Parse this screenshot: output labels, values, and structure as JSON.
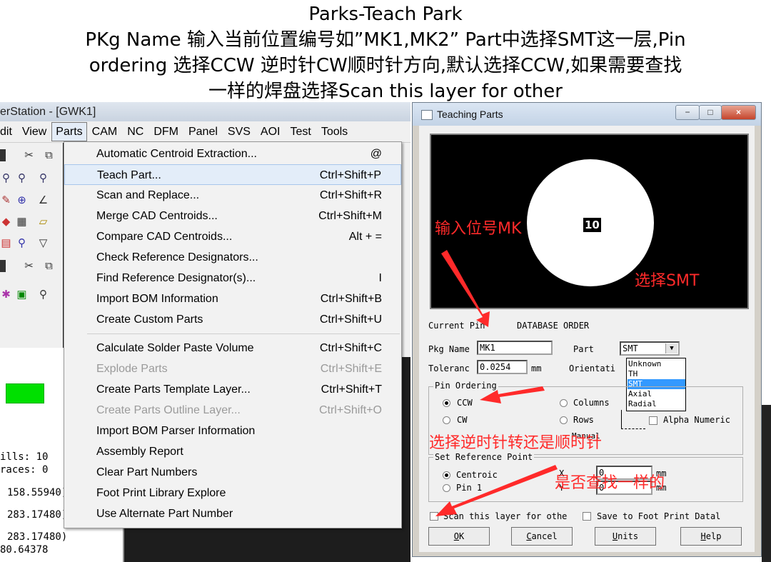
{
  "slide": {
    "title_line1": "Parks-Teach Park",
    "title_line2": "PKg Name 输入当前位置编号如”MK1,MK2”  Part中选择SMT这一层,Pin",
    "title_line3": "ordering 选择CCW 逆时针CW顺时针方向,默认选择CCW,如果需要查找",
    "title_line4": "一样的焊盘选择Scan this layer for other"
  },
  "app": {
    "title": "erStation - [GWK1]",
    "menu": [
      "dit",
      "View",
      "Parts",
      "CAM",
      "NC",
      "DFM",
      "Panel",
      "SVS",
      "AOI",
      "Test",
      "Tools"
    ],
    "info_lines": [
      "ills: 10",
      "races: 0",
      "158.55940)",
      "283.17480)",
      "283.17480)",
      "80.64378"
    ]
  },
  "parts_menu": {
    "items": [
      {
        "label": "Automatic Centroid Extraction...",
        "shortcut": "@"
      },
      {
        "label": "Teach Part...",
        "shortcut": "Ctrl+Shift+P"
      },
      {
        "label": "Scan and Replace...",
        "shortcut": "Ctrl+Shift+R"
      },
      {
        "label": "Merge CAD Centroids...",
        "shortcut": "Ctrl+Shift+M"
      },
      {
        "label": "Compare CAD Centroids...",
        "shortcut": "Alt + ="
      },
      {
        "label": "Check Reference Designators...",
        "shortcut": ""
      },
      {
        "label": "Find Reference Designator(s)...",
        "shortcut": "I"
      },
      {
        "label": "Import BOM Information",
        "shortcut": "Ctrl+Shift+B"
      },
      {
        "label": "Create Custom Parts",
        "shortcut": "Ctrl+Shift+U"
      },
      {
        "label": "Calculate Solder Paste Volume",
        "shortcut": "Ctrl+Shift+C"
      },
      {
        "label": "Explode Parts",
        "shortcut": "Ctrl+Shift+E"
      },
      {
        "label": "Create Parts Template Layer...",
        "shortcut": "Ctrl+Shift+T"
      },
      {
        "label": "Create Parts Outline Layer...",
        "shortcut": "Ctrl+Shift+O"
      },
      {
        "label": "Import BOM Parser Information",
        "shortcut": ""
      },
      {
        "label": "Assembly Report",
        "shortcut": ""
      },
      {
        "label": "Clear Part Numbers",
        "shortcut": ""
      },
      {
        "label": "Foot Print Library Explore",
        "shortcut": ""
      },
      {
        "label": "Use Alternate Part Number",
        "shortcut": ""
      }
    ]
  },
  "teach_dialog": {
    "title": "Teaching Parts",
    "window_buttons": [
      "−",
      "□",
      "×"
    ],
    "pin_number": "10",
    "current_pin_label": "Current Pin",
    "current_pin_value": "DATABASE ORDER",
    "pkg_name_label": "Pkg Name",
    "pkg_name_value": "MK1",
    "part_label": "Part",
    "part_value": "SMT",
    "part_options": [
      "Unknown",
      "TH",
      "SMT",
      "Axial",
      "Radial"
    ],
    "tolerance_label": "Toleranc",
    "tolerance_value": "0.0254",
    "tolerance_unit": "mm",
    "orientation_label": "Orientati",
    "pin_ordering": {
      "title": "Pin Ordering",
      "ccw": "CCW",
      "cw": "CW",
      "columns": "Columns",
      "rows": "Rows",
      "alpha_numeric": "Alpha Numeric",
      "manual": "Manual"
    },
    "ref_point": {
      "title": "Set Reference Point",
      "centroid": "Centroic",
      "pin1": "Pin 1",
      "x_label": "X",
      "y_label": "Y",
      "x_value": "0",
      "y_value": "0",
      "unit": "mm"
    },
    "scan_layer": "Scan this layer for othe",
    "save_footprint": "Save to Foot Print Datal",
    "buttons": {
      "ok_u": "O",
      "ok_rest": "K",
      "cancel_u": "C",
      "cancel_rest": "ancel",
      "units_u": "U",
      "units_rest": "nits",
      "help_u": "H",
      "help_rest": "elp"
    }
  },
  "annotations": {
    "input_ref": "输入位号MK",
    "select_smt": "选择SMT",
    "select_direction": "选择逆时针转还是顺时针",
    "find_same": "是否查找一样的"
  },
  "colors": {
    "annotation_red": "#ff2a2a",
    "highlight": "#e3edf9",
    "selection_blue": "#3399ff",
    "pad_green": "#00e000"
  }
}
